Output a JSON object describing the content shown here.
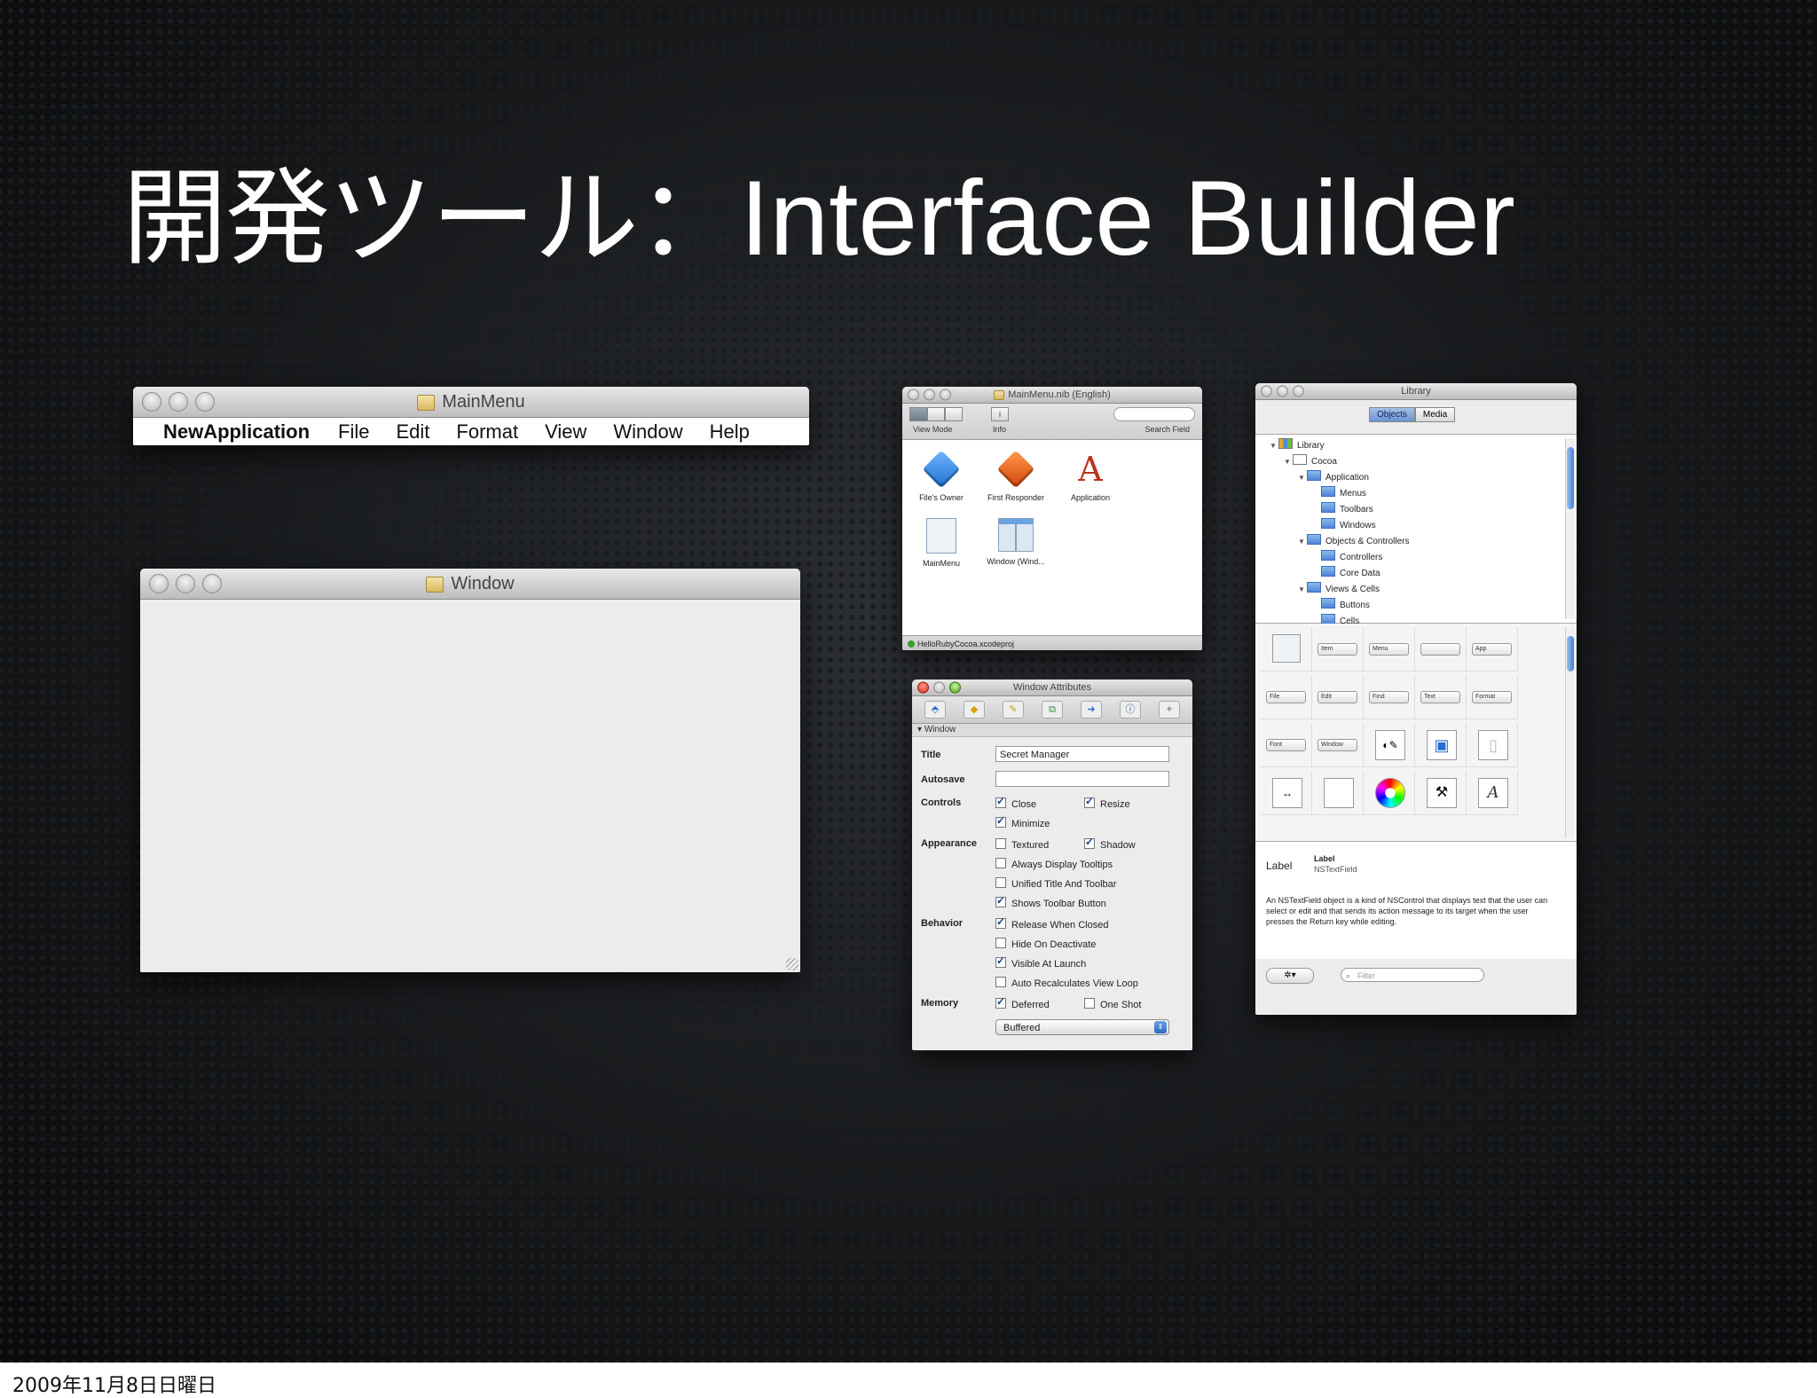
{
  "slide": {
    "title_jp": "開発ツール：",
    "title_en": "Interface Builder",
    "footer_date": "2009年11月8日日曜日"
  },
  "main_menu_window": {
    "title": "MainMenu",
    "menu_items": [
      "NewApplication",
      "File",
      "Edit",
      "Format",
      "View",
      "Window",
      "Help"
    ]
  },
  "empty_window": {
    "title": "Window"
  },
  "nib_window": {
    "title": "MainMenu.nib (English)",
    "toolbar": {
      "view_mode": "View Mode",
      "info": "Info",
      "search_field": "Search Field"
    },
    "items": [
      "File's Owner",
      "First Responder",
      "Application",
      "MainMenu",
      "Window (Wind..."
    ],
    "status": "HelloRubyCocoa.xcodeproj"
  },
  "inspector": {
    "title": "Window Attributes",
    "section": "Window",
    "title_label": "Title",
    "title_value": "Secret Manager",
    "autosave_label": "Autosave",
    "autosave_value": "",
    "controls_label": "Controls",
    "appearance_label": "Appearance",
    "behavior_label": "Behavior",
    "memory_label": "Memory",
    "checks": {
      "close": {
        "label": "Close",
        "checked": true
      },
      "resize": {
        "label": "Resize",
        "checked": true
      },
      "minimize": {
        "label": "Minimize",
        "checked": true
      },
      "textured": {
        "label": "Textured",
        "checked": false
      },
      "shadow": {
        "label": "Shadow",
        "checked": true
      },
      "always_tooltips": {
        "label": "Always Display Tooltips",
        "checked": false
      },
      "unified": {
        "label": "Unified Title And Toolbar",
        "checked": false
      },
      "toolbar_button": {
        "label": "Shows Toolbar Button",
        "checked": true
      },
      "release_closed": {
        "label": "Release When Closed",
        "checked": true
      },
      "hide_deactivate": {
        "label": "Hide On Deactivate",
        "checked": false
      },
      "visible_launch": {
        "label": "Visible At Launch",
        "checked": true
      },
      "auto_recalc": {
        "label": "Auto Recalculates View Loop",
        "checked": false
      },
      "deferred": {
        "label": "Deferred",
        "checked": true
      },
      "one_shot": {
        "label": "One Shot",
        "checked": false
      }
    },
    "backing": "Buffered"
  },
  "library": {
    "title": "Library",
    "tabs": [
      "Objects",
      "Media"
    ],
    "tree": [
      "Library",
      "Cocoa",
      "Application",
      "Menus",
      "Toolbars",
      "Windows",
      "Objects & Controllers",
      "Controllers",
      "Core Data",
      "Views & Cells",
      "Buttons",
      "Cells"
    ],
    "grid_labels": [
      "Item",
      "Menu",
      "App",
      "File",
      "Edit",
      "Find",
      "Text",
      "Format",
      "Font",
      "Window"
    ],
    "desc_icon_label": "Label",
    "desc_title": "Label",
    "desc_class": "NSTextField",
    "desc_text": "An NSTextField object is a kind of NSControl that displays text that the user can select or edit and that sends its action message to its target when the user presses the Return key while editing.",
    "filter_placeholder": "Filter",
    "gear_label": "✲▾"
  }
}
